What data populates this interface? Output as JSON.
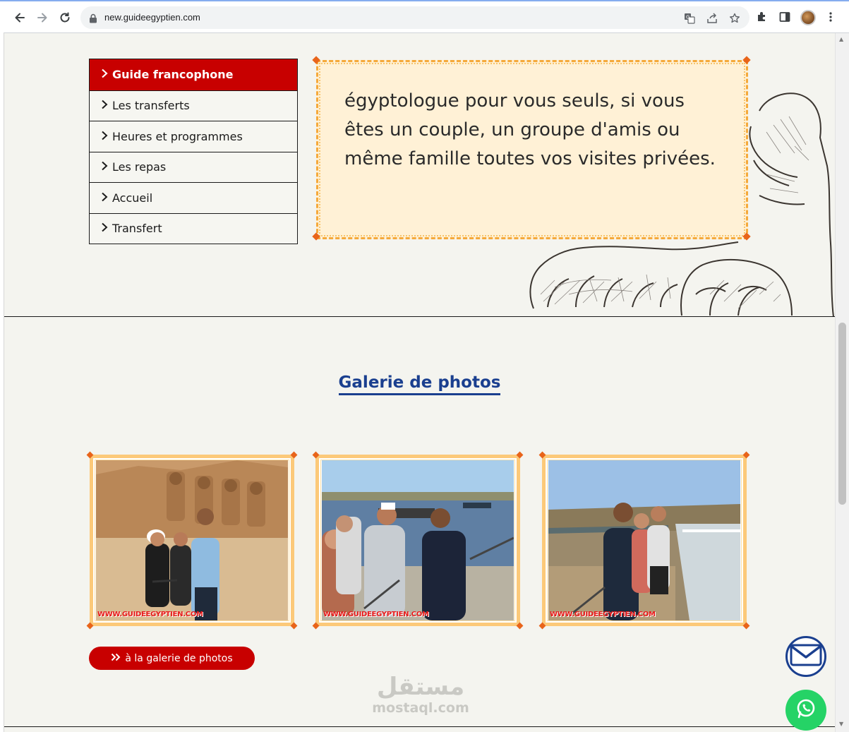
{
  "browser": {
    "url": "new.guideegyptien.com"
  },
  "sidebar": {
    "items": [
      {
        "label": "Guide francophone",
        "active": true
      },
      {
        "label": "Les transferts",
        "active": false
      },
      {
        "label": "Heures et programmes",
        "active": false
      },
      {
        "label": "Les repas",
        "active": false
      },
      {
        "label": "Accueil",
        "active": false
      },
      {
        "label": "Transfert",
        "active": false
      }
    ]
  },
  "intro": {
    "text": "égyptologue pour vous seuls, si vous êtes un couple, un groupe d'amis ou même famille toutes vos visites privées."
  },
  "gallery": {
    "title": "Galerie de photos",
    "photos": [
      {
        "watermark": "WWW.GUIDEEGYPTIEN.COM"
      },
      {
        "watermark": "WWW.GUIDEEGYPTIEN.COM"
      },
      {
        "watermark": "WWW.GUIDEEGYPTIEN.COM"
      }
    ],
    "button_label": "à la galerie de photos"
  },
  "site_watermark": {
    "arabic": "مستقل",
    "latin": "mostaql.com"
  },
  "colors": {
    "brand_red": "#c80000",
    "title_blue": "#1a3f8f",
    "frame_orange": "#f5a93b",
    "whatsapp_green": "#25d366"
  },
  "icons": [
    "back-arrow-icon",
    "forward-arrow-icon",
    "reload-icon",
    "lock-icon",
    "translate-icon",
    "share-icon",
    "star-icon",
    "extensions-icon",
    "sidebar-icon",
    "menu-dots-icon",
    "chevron-right-icon",
    "double-chevron-right-icon",
    "mail-icon",
    "whatsapp-icon"
  ]
}
